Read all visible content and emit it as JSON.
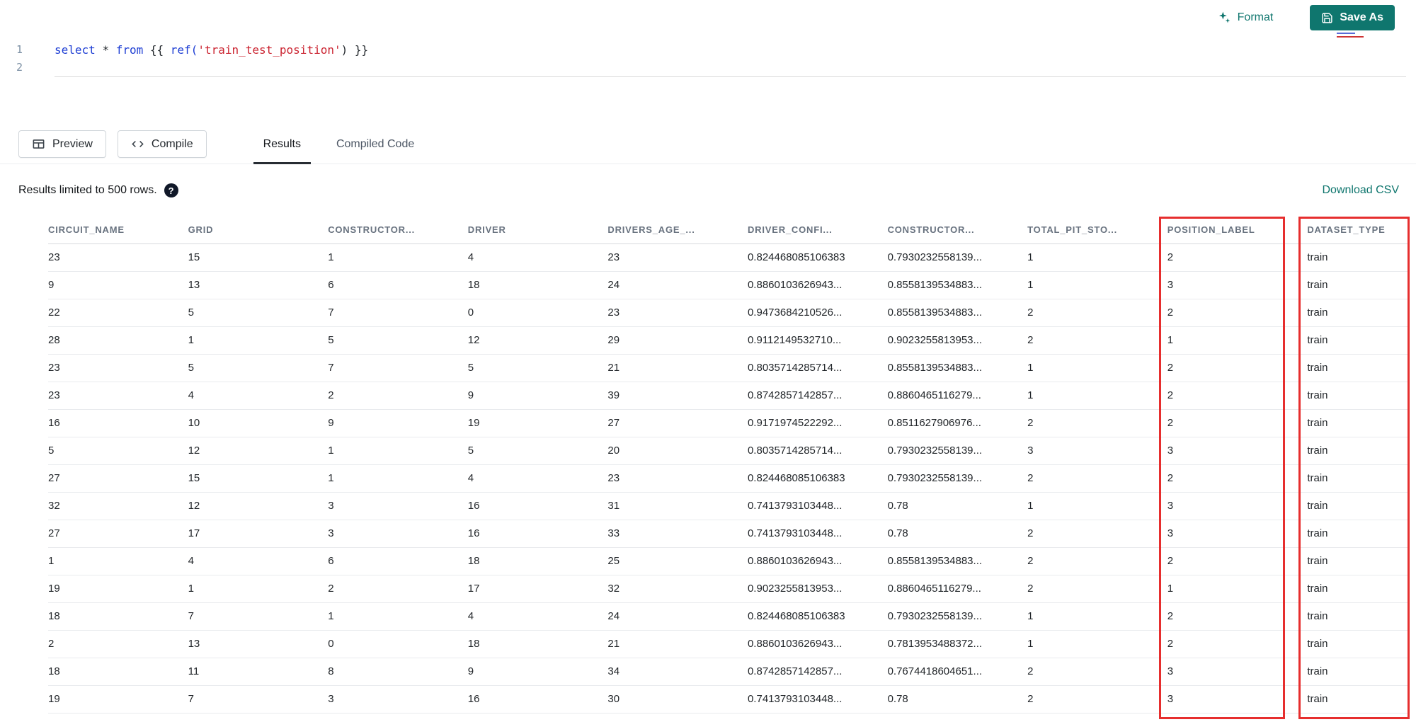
{
  "colors": {
    "accent": "#0f766e",
    "highlight": "#e62e2e"
  },
  "toolbar": {
    "format_label": "Format",
    "save_as_label": "Save As"
  },
  "editor": {
    "line_numbers": [
      "1",
      "2"
    ],
    "line1": {
      "kw_select": "select ",
      "op_star": "* ",
      "kw_from": "from ",
      "brace_open": "{{ ",
      "fn_ref": "ref(",
      "str_arg": "'train_test_position'",
      "tail": ") }}"
    }
  },
  "pane": {
    "preview_label": "Preview",
    "compile_label": "Compile",
    "tabs": [
      {
        "label": "Results",
        "active": true
      },
      {
        "label": "Compiled Code",
        "active": false
      }
    ]
  },
  "results": {
    "limit_note": "Results limited to 500 rows.",
    "help_glyph": "?",
    "download_csv": "Download CSV"
  },
  "table": {
    "columns": [
      "CIRCUIT_NAME",
      "GRID",
      "CONSTRUCTOR...",
      "DRIVER",
      "DRIVERS_AGE_...",
      "DRIVER_CONFI...",
      "CONSTRUCTOR...",
      "TOTAL_PIT_STO...",
      "POSITION_LABEL",
      "DATASET_TYPE"
    ],
    "highlighted_columns": [
      "POSITION_LABEL",
      "DATASET_TYPE"
    ],
    "rows": [
      [
        "23",
        "15",
        "1",
        "4",
        "23",
        "0.824468085106383",
        "0.7930232558139...",
        "1",
        "2",
        "train"
      ],
      [
        "9",
        "13",
        "6",
        "18",
        "24",
        "0.8860103626943...",
        "0.8558139534883...",
        "1",
        "3",
        "train"
      ],
      [
        "22",
        "5",
        "7",
        "0",
        "23",
        "0.9473684210526...",
        "0.8558139534883...",
        "2",
        "2",
        "train"
      ],
      [
        "28",
        "1",
        "5",
        "12",
        "29",
        "0.9112149532710...",
        "0.9023255813953...",
        "2",
        "1",
        "train"
      ],
      [
        "23",
        "5",
        "7",
        "5",
        "21",
        "0.8035714285714...",
        "0.8558139534883...",
        "1",
        "2",
        "train"
      ],
      [
        "23",
        "4",
        "2",
        "9",
        "39",
        "0.8742857142857...",
        "0.8860465116279...",
        "1",
        "2",
        "train"
      ],
      [
        "16",
        "10",
        "9",
        "19",
        "27",
        "0.9171974522292...",
        "0.8511627906976...",
        "2",
        "2",
        "train"
      ],
      [
        "5",
        "12",
        "1",
        "5",
        "20",
        "0.8035714285714...",
        "0.7930232558139...",
        "3",
        "3",
        "train"
      ],
      [
        "27",
        "15",
        "1",
        "4",
        "23",
        "0.824468085106383",
        "0.7930232558139...",
        "2",
        "2",
        "train"
      ],
      [
        "32",
        "12",
        "3",
        "16",
        "31",
        "0.7413793103448...",
        "0.78",
        "1",
        "3",
        "train"
      ],
      [
        "27",
        "17",
        "3",
        "16",
        "33",
        "0.7413793103448...",
        "0.78",
        "2",
        "3",
        "train"
      ],
      [
        "1",
        "4",
        "6",
        "18",
        "25",
        "0.8860103626943...",
        "0.8558139534883...",
        "2",
        "2",
        "train"
      ],
      [
        "19",
        "1",
        "2",
        "17",
        "32",
        "0.9023255813953...",
        "0.8860465116279...",
        "2",
        "1",
        "train"
      ],
      [
        "18",
        "7",
        "1",
        "4",
        "24",
        "0.824468085106383",
        "0.7930232558139...",
        "1",
        "2",
        "train"
      ],
      [
        "2",
        "13",
        "0",
        "18",
        "21",
        "0.8860103626943...",
        "0.7813953488372...",
        "1",
        "2",
        "train"
      ],
      [
        "18",
        "11",
        "8",
        "9",
        "34",
        "0.8742857142857...",
        "0.7674418604651...",
        "2",
        "3",
        "train"
      ],
      [
        "19",
        "7",
        "3",
        "16",
        "30",
        "0.7413793103448...",
        "0.78",
        "2",
        "3",
        "train"
      ]
    ]
  }
}
